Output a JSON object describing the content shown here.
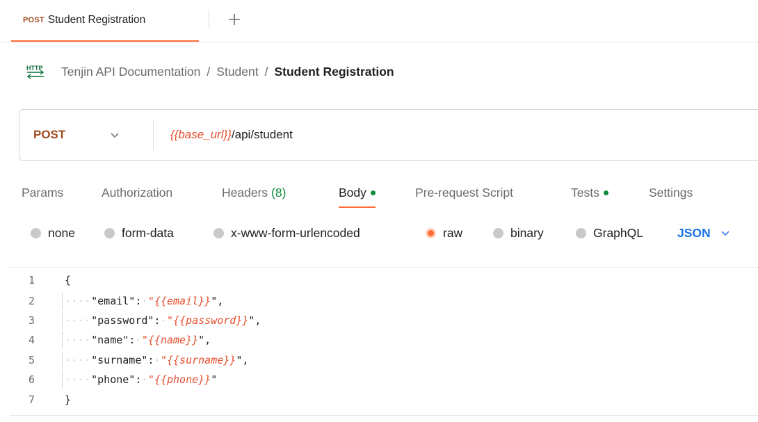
{
  "tab": {
    "method": "POST",
    "title": "Student Registration"
  },
  "breadcrumb": {
    "items": [
      "Tenjin API Documentation",
      "Student"
    ],
    "current": "Student Registration",
    "separator": "/"
  },
  "request": {
    "method": "POST",
    "url_variable": "{{base_url}}",
    "url_path": "/api/student"
  },
  "request_tabs": [
    {
      "label": "Params"
    },
    {
      "label": "Authorization"
    },
    {
      "label": "Headers",
      "count": "(8)"
    },
    {
      "label": "Body",
      "active": true,
      "indicator": "green-dot"
    },
    {
      "label": "Pre-request Script"
    },
    {
      "label": "Tests",
      "indicator": "green-dot"
    },
    {
      "label": "Settings"
    }
  ],
  "body_types": [
    "none",
    "form-data",
    "x-www-form-urlencoded",
    "raw",
    "binary",
    "GraphQL"
  ],
  "body_type_selected": "raw",
  "language": "JSON",
  "code_lines": [
    {
      "n": "1",
      "text": "{"
    },
    {
      "n": "2",
      "key": "\"email\"",
      "value": "{{email}}",
      "trail": "\","
    },
    {
      "n": "3",
      "key": "\"password\"",
      "value": "{{password}}",
      "trail": "\","
    },
    {
      "n": "4",
      "key": "\"name\"",
      "value": "{{name}}",
      "trail": "\","
    },
    {
      "n": "5",
      "key": "\"surname\"",
      "value": "{{surname}}",
      "trail": "\","
    },
    {
      "n": "6",
      "key": "\"phone\"",
      "value": "{{phone}}",
      "trail": "\""
    },
    {
      "n": "7",
      "text": "}"
    }
  ],
  "colors": {
    "accent": "#ff6c37",
    "method": "#a04a20",
    "variable": "#e5502f",
    "green_indicator": "#0f8a3c",
    "language_link": "#1a73e8"
  },
  "icons": {
    "new_tab": "plus-icon",
    "http": "http-icon",
    "dropdown": "chevron-down-icon"
  }
}
